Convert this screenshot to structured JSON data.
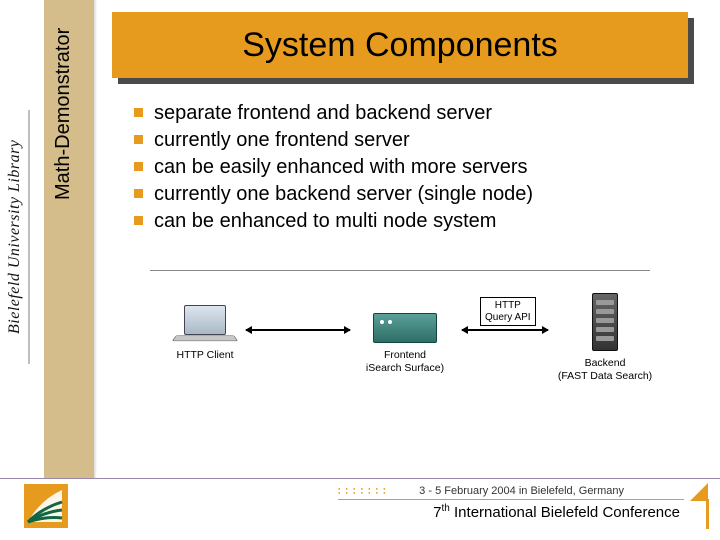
{
  "title": "System Components",
  "sidebar": {
    "brand_text": "Bielefeld University Library",
    "strip_label": "Math-Demonstrator"
  },
  "bullets": [
    "separate frontend and backend server",
    "currently one frontend server",
    "can be easily enhanced with more servers",
    "currently one backend server (single node)",
    "can be enhanced to multi node system"
  ],
  "diagram": {
    "client_caption": "HTTP Client",
    "frontend_caption_line1": "Frontend",
    "frontend_caption_line2": "iSearch Surface)",
    "backend_caption_line1": "Backend",
    "backend_caption_line2": "(FAST Data Search)",
    "api_label_line1": "HTTP",
    "api_label_line2": "Query API"
  },
  "footer": {
    "date_text": "3 - 5 February 2004 in Bielefeld, Germany",
    "conf_ordinal_num": "7",
    "conf_ordinal_suffix": "th",
    "conf_text": " International Bielefeld Conference"
  }
}
